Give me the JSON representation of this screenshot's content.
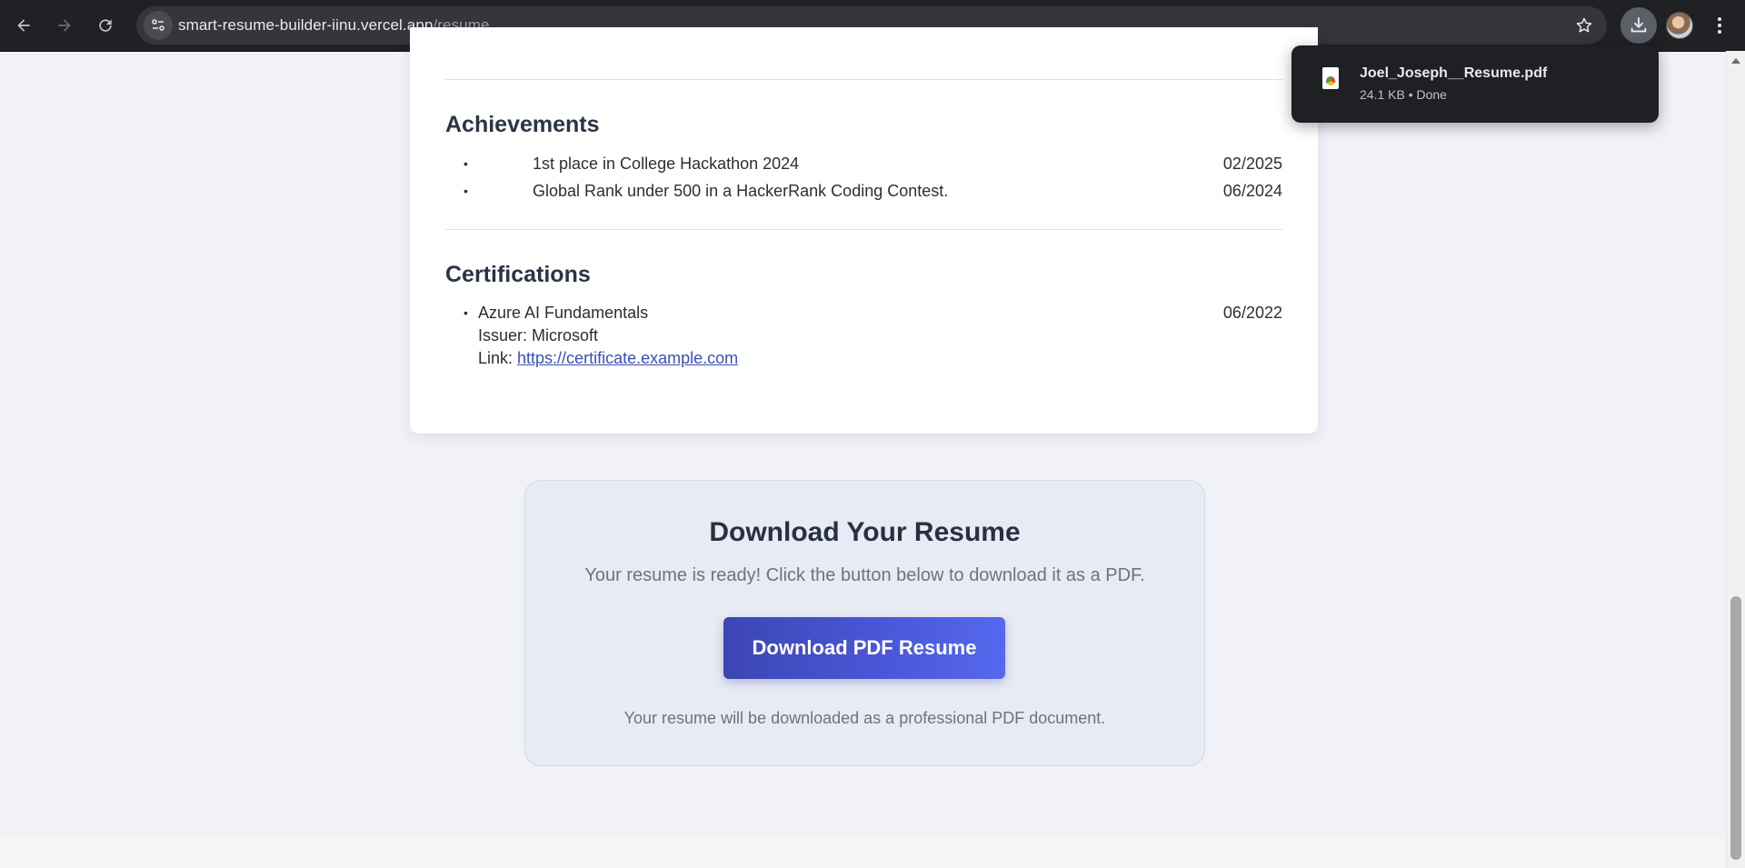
{
  "browser": {
    "url_host": "smart-resume-builder-iinu.vercel.app",
    "url_path": "/resume",
    "icons": [
      "back-arrow-icon",
      "forward-arrow-icon",
      "reload-icon",
      "site-settings-icon",
      "bookmark-star-icon",
      "download-icon",
      "profile-avatar",
      "kebab-menu-icon"
    ]
  },
  "download_bubble": {
    "filename": "Joel_Joseph__Resume.pdf",
    "meta": "24.1 KB • Done",
    "icon": "chrome-file-icon"
  },
  "resume": {
    "achievements": {
      "title": "Achievements",
      "items": [
        {
          "bullet": "•",
          "text": "1st place in College Hackathon 2024",
          "date": "02/2025"
        },
        {
          "bullet": "•",
          "text": "Global Rank under 500 in a HackerRank Coding Contest.",
          "date": "06/2024"
        }
      ]
    },
    "certifications": {
      "title": "Certifications",
      "items": [
        {
          "bullet": "•",
          "name": "Azure AI Fundamentals",
          "issuer_line": "Issuer: Microsoft",
          "link_label": "Link: ",
          "link": "https://certificate.example.com",
          "date": "06/2022"
        }
      ]
    }
  },
  "download_panel": {
    "title": "Download Your Resume",
    "subtitle": "Your resume is ready! Click the button below to download it as a PDF.",
    "button_label": "Download PDF Resume",
    "note": "Your resume will be downloaded as a professional PDF document."
  },
  "colors": {
    "accent": "#4a58da",
    "page_bg": "#f1f2f8",
    "chrome_bg": "#202124"
  }
}
